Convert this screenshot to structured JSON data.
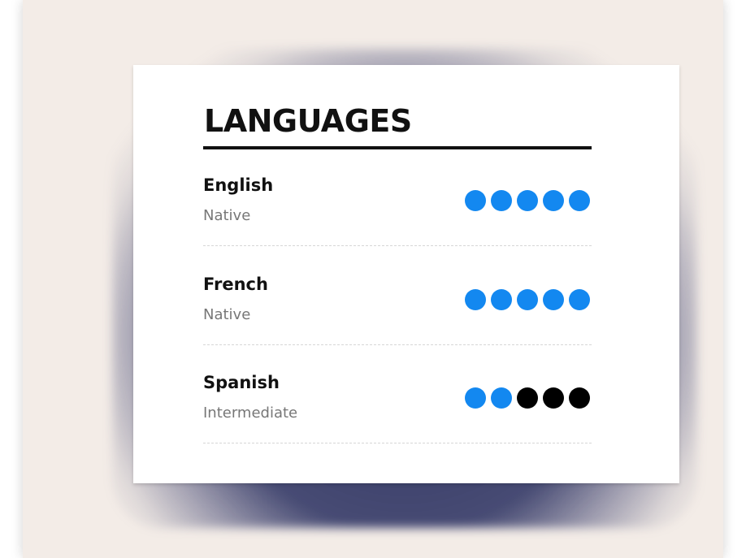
{
  "section": {
    "title": "LANGUAGES"
  },
  "languages": [
    {
      "name": "English",
      "level": "Native",
      "rating": 5,
      "max": 5
    },
    {
      "name": "French",
      "level": "Native",
      "rating": 5,
      "max": 5
    },
    {
      "name": "Spanish",
      "level": "Intermediate",
      "rating": 2,
      "max": 5
    }
  ],
  "colors": {
    "filled_dot": "#1388f0",
    "empty_dot": "#000000"
  }
}
